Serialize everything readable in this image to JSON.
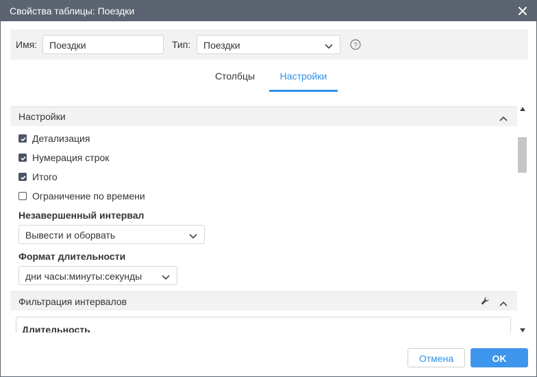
{
  "window": {
    "title": "Свойства таблицы: Поездки",
    "close_icon": "close-icon"
  },
  "header": {
    "name_label": "Имя:",
    "name_value": "Поездки",
    "type_label": "Тип:",
    "type_value": "Поездки",
    "help_icon": "help-circle-icon"
  },
  "tabs": [
    {
      "label": "Столбцы",
      "active": false
    },
    {
      "label": "Настройки",
      "active": true
    }
  ],
  "settings_section": {
    "title": "Настройки",
    "checkboxes": [
      {
        "label": "Детализация",
        "checked": true
      },
      {
        "label": "Нумерация строк",
        "checked": true
      },
      {
        "label": "Итого",
        "checked": true
      },
      {
        "label": "Ограничение по времени",
        "checked": false
      }
    ],
    "incomplete_interval_label": "Незавершенный интервал",
    "incomplete_interval_value": "Вывести и оборвать",
    "duration_format_label": "Формат длительности",
    "duration_format_value": "дни часы:минуты:секунды"
  },
  "filter_section": {
    "title": "Фильтрация интервалов",
    "duration_label": "Длительность"
  },
  "footer": {
    "cancel_label": "Отмена",
    "ok_label": "OK"
  },
  "colors": {
    "titlebar": "#5b6470",
    "accent": "#2f8fe8",
    "ok_button": "#3d95ec",
    "section_bg": "#f2f2f2"
  }
}
